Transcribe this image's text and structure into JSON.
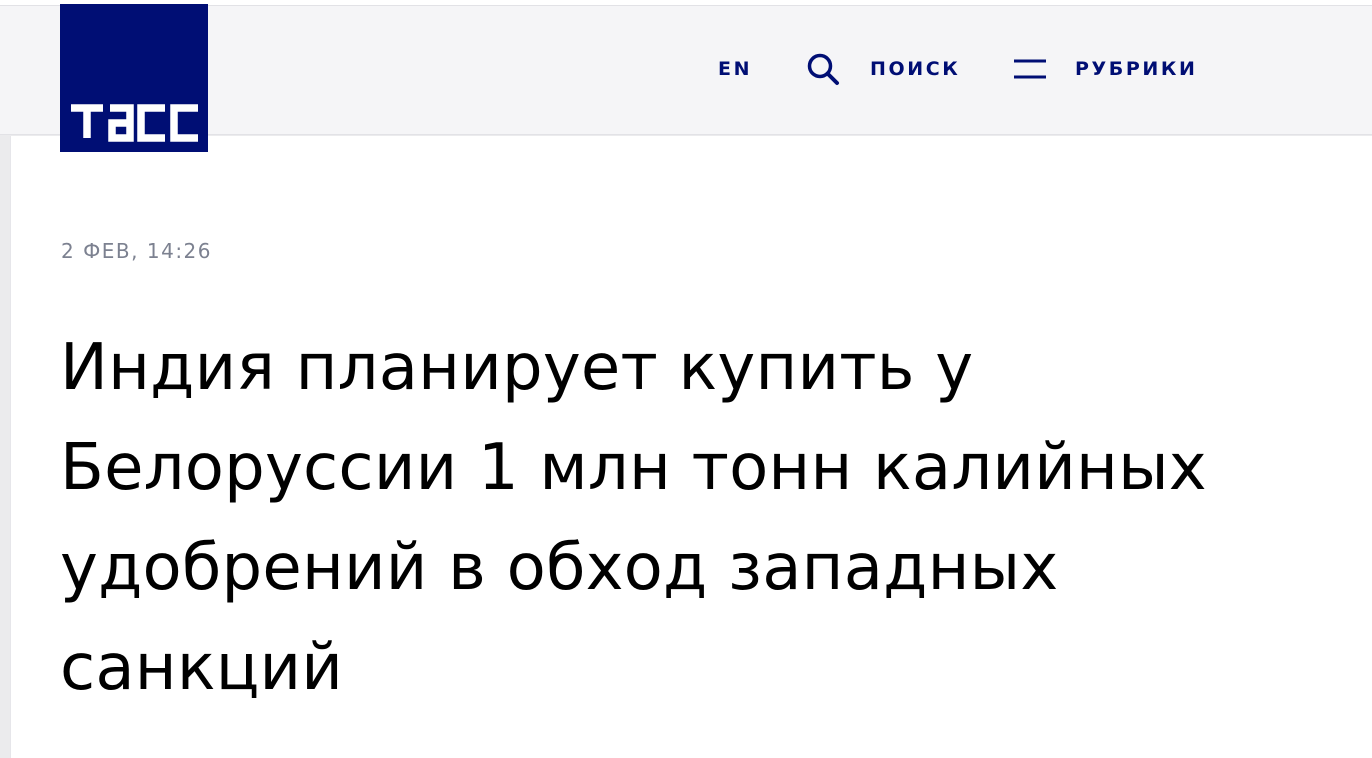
{
  "brand": {
    "logo_text": "тасс",
    "color": "#000e74"
  },
  "header": {
    "nav": {
      "lang_label": "EN",
      "search_label": "ПОИСК",
      "search_icon": "search-icon",
      "rubrics_label": "РУБРИКИ",
      "rubrics_icon": "menu-icon"
    }
  },
  "article": {
    "date": "2 ФЕВ, 14:26",
    "headline": "Индия планирует купить у Белоруссии 1 млн тонн калийных удобрений в обход западных санкций"
  }
}
